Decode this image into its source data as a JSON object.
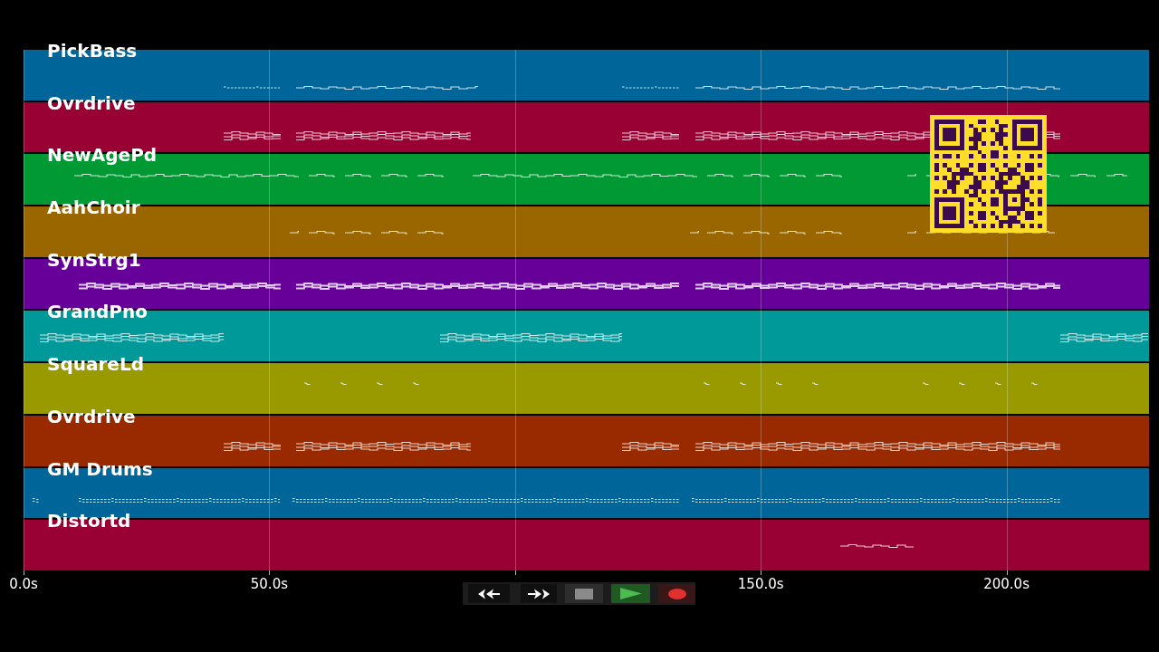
{
  "tracks": [
    {
      "name": "PickBass",
      "color": "#006699"
    },
    {
      "name": "Ovrdrive",
      "color": "#990033"
    },
    {
      "name": "NewAgePd",
      "color": "#009933"
    },
    {
      "name": "AahChoir",
      "color": "#996600"
    },
    {
      "name": "SynStrg1",
      "color": "#660099"
    },
    {
      "name": "GrandPno",
      "color": "#009999"
    },
    {
      "name": "SquareLd",
      "color": "#999900"
    },
    {
      "name": "Ovrdrive",
      "color": "#992a00"
    },
    {
      "name": "GM Drums",
      "color": "#006699"
    },
    {
      "name": "Distortd",
      "color": "#990033"
    }
  ],
  "time_axis": {
    "labels": [
      "0.0s",
      "50.0s",
      "150.0s",
      "200.0s"
    ]
  },
  "transport": {
    "buttons": [
      {
        "kind": "rewind"
      },
      {
        "kind": "fast_forward"
      },
      {
        "kind": "stop"
      },
      {
        "kind": "play"
      },
      {
        "kind": "record"
      }
    ]
  }
}
